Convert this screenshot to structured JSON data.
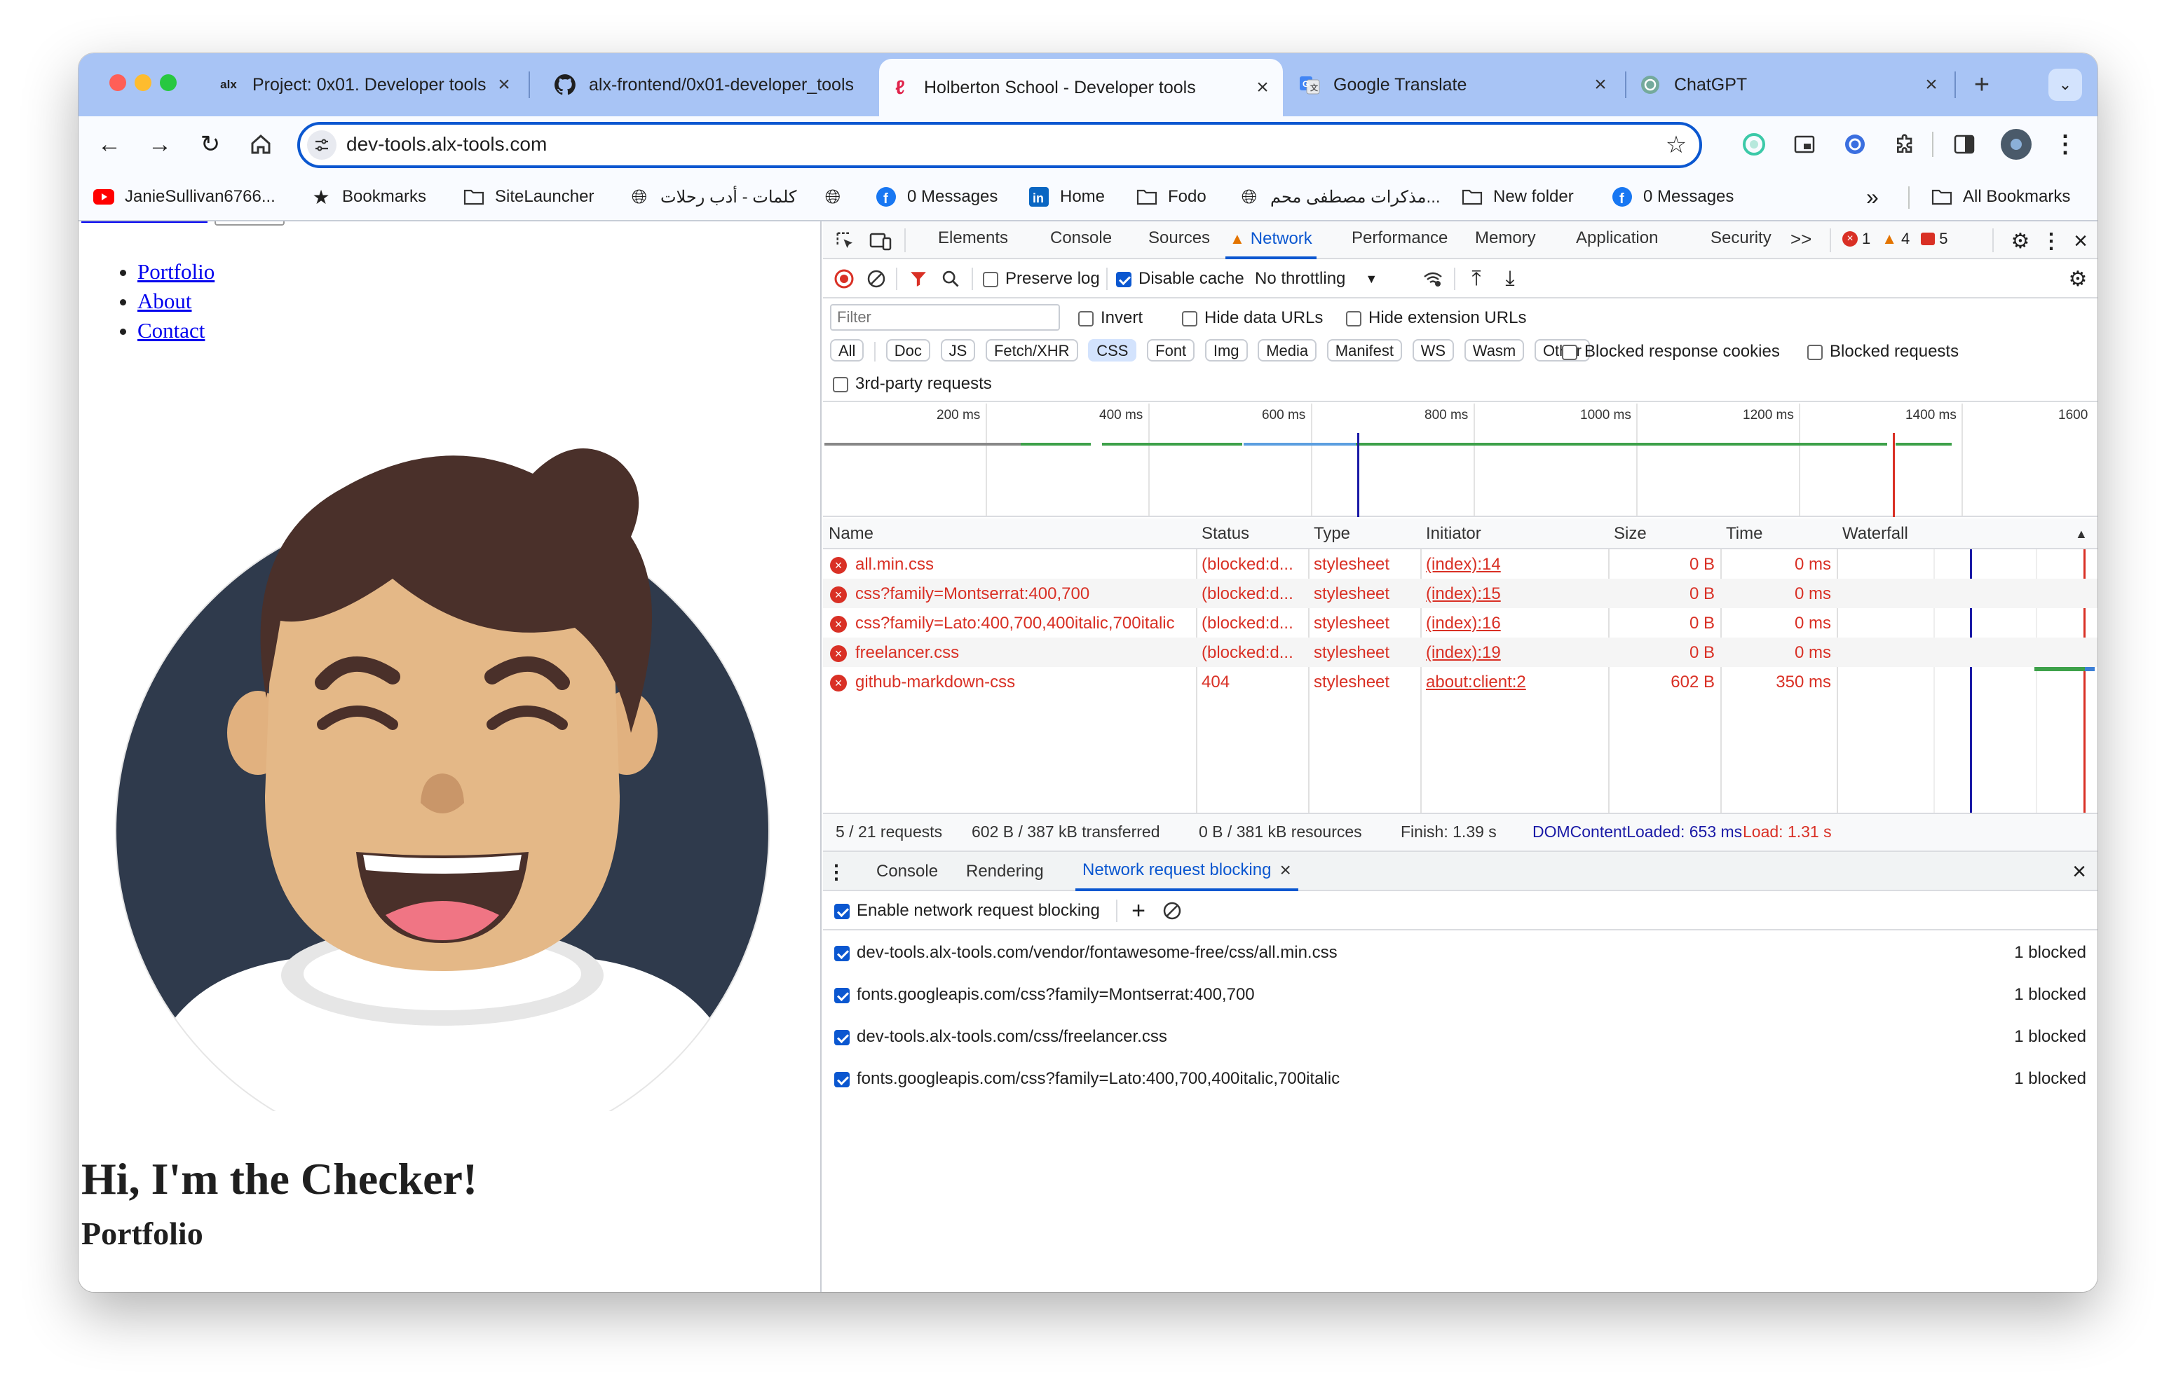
{
  "browser": {
    "tabs": [
      {
        "icon": "alx",
        "title": "Project: 0x01. Developer tools"
      },
      {
        "icon": "github",
        "title": "alx-frontend/0x01-developer_tools"
      },
      {
        "icon": "holberton",
        "title": "Holberton School - Developer tools"
      },
      {
        "icon": "translate",
        "title": "Google Translate"
      },
      {
        "icon": "chatgpt",
        "title": "ChatGPT"
      }
    ],
    "new_tab": "+",
    "url": "dev-tools.alx-tools.com",
    "bookmarks": [
      "JanieSullivan6766...",
      "Bookmarks",
      "SiteLauncher",
      "كلمات - أدب رحلات",
      "",
      "0 Messages",
      "Home",
      "Fodo",
      "مذكرات مصطفى محم...",
      "New folder",
      "0 Messages"
    ],
    "more": "»",
    "all_bookmarks": "All Bookmarks"
  },
  "page": {
    "nav": [
      "Portfolio",
      "About",
      "Contact"
    ],
    "heading": "Hi, I'm the Checker!",
    "subheading": "Portfolio"
  },
  "devtools": {
    "panels": [
      "Elements",
      "Console",
      "Sources",
      "Network",
      "Performance",
      "Memory",
      "Application",
      "Security"
    ],
    "active_panel": "Network",
    "overflow": ">>",
    "errors": "1",
    "warnings": "4",
    "issues": "5",
    "preserve_log": "Preserve log",
    "disable_cache": "Disable cache",
    "throttling": "No throttling",
    "filter_placeholder": "Filter",
    "invert": "Invert",
    "hide_data_urls": "Hide data URLs",
    "hide_extension_urls": "Hide extension URLs",
    "filter_types": [
      "All",
      "Doc",
      "JS",
      "Fetch/XHR",
      "CSS",
      "Font",
      "Img",
      "Media",
      "Manifest",
      "WS",
      "Wasm",
      "Other"
    ],
    "selected_type": "CSS",
    "blocked_cookies": "Blocked response cookies",
    "blocked_requests": "Blocked requests",
    "third_party": "3rd-party requests",
    "timeline_ticks": [
      "200 ms",
      "400 ms",
      "600 ms",
      "800 ms",
      "1000 ms",
      "1200 ms",
      "1400 ms",
      "1600"
    ],
    "columns": [
      "Name",
      "Status",
      "Type",
      "Initiator",
      "Size",
      "Time",
      "Waterfall"
    ],
    "requests": [
      {
        "name": "all.min.css",
        "status": "(blocked:d...",
        "type": "stylesheet",
        "initiator": "(index):14",
        "size": "0 B",
        "time": "0 ms"
      },
      {
        "name": "css?family=Montserrat:400,700",
        "status": "(blocked:d...",
        "type": "stylesheet",
        "initiator": "(index):15",
        "size": "0 B",
        "time": "0 ms"
      },
      {
        "name": "css?family=Lato:400,700,400italic,700italic",
        "status": "(blocked:d...",
        "type": "stylesheet",
        "initiator": "(index):16",
        "size": "0 B",
        "time": "0 ms"
      },
      {
        "name": "freelancer.css",
        "status": "(blocked:d...",
        "type": "stylesheet",
        "initiator": "(index):19",
        "size": "0 B",
        "time": "0 ms"
      },
      {
        "name": "github-markdown-css",
        "status": "404",
        "type": "stylesheet",
        "initiator": "about:client:2",
        "size": "602 B",
        "time": "350 ms"
      }
    ],
    "summary": {
      "requests": "5 / 21 requests",
      "transferred": "602 B / 387 kB transferred",
      "resources": "0 B / 381 kB resources",
      "finish": "Finish: 1.39 s",
      "dcl": "DOMContentLoaded: 653 ms",
      "load": "Load: 1.31 s"
    },
    "drawer_tabs": [
      "Console",
      "Rendering",
      "Network request blocking"
    ],
    "active_drawer": "Network request blocking",
    "enable_blocking": "Enable network request blocking",
    "blocked_patterns": [
      {
        "pattern": "dev-tools.alx-tools.com/vendor/fontawesome-free/css/all.min.css",
        "count": "1 blocked"
      },
      {
        "pattern": "fonts.googleapis.com/css?family=Montserrat:400,700",
        "count": "1 blocked"
      },
      {
        "pattern": "dev-tools.alx-tools.com/css/freelancer.css",
        "count": "1 blocked"
      },
      {
        "pattern": "fonts.googleapis.com/css?family=Lato:400,700,400italic,700italic",
        "count": "1 blocked"
      }
    ]
  },
  "colors": {
    "tabbar": "#a8c4f5",
    "accent": "#0b57d0",
    "error": "#d93025",
    "dcl": "#1a1aa6",
    "avatar_bg": "#2f3a4c"
  }
}
